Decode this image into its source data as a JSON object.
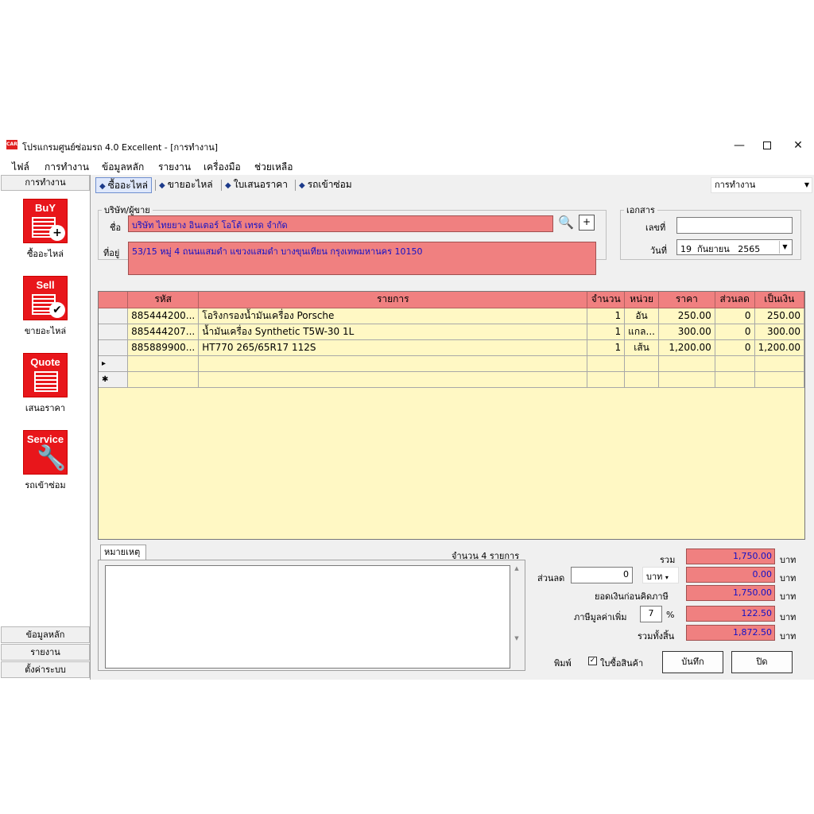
{
  "window": {
    "title": "โปรแกรมศูนย์ซ่อมรถ 4.0 Excellent - [การทำงาน]",
    "logo_text": "CAR",
    "minimize": "—",
    "close": "✕"
  },
  "menu": [
    "ไฟล์",
    "การทำงาน",
    "ข้อมูลหลัก",
    "รายงาน",
    "เครื่องมือ",
    "ช่วยเหลือ"
  ],
  "sidebar": {
    "header": "การทำงาน",
    "tiles": [
      {
        "word": "BuY",
        "label": "ซื้ออะไหล่",
        "icon": "buy-icon"
      },
      {
        "word": "Sell",
        "label": "ขายอะไหล่",
        "icon": "sell-icon"
      },
      {
        "word": "Quote",
        "label": "เสนอราคา",
        "icon": "quote-icon"
      },
      {
        "word": "Service",
        "label": "รถเข้าซ่อม",
        "icon": "service-icon"
      }
    ],
    "bottom": [
      "ข้อมูลหลัก",
      "รายงาน",
      "ตั้งค่าระบบ"
    ]
  },
  "tabs": [
    "ซื้ออะไหล่",
    "ขายอะไหล่",
    "ใบเสนอราคา",
    "รถเข้าซ่อม"
  ],
  "mode_select": "การทำงาน",
  "supplier": {
    "legend": "บริษัท/ผู้ขาย",
    "name_label": "ชื่อ",
    "name": "บริษัท ไทยยาง อินเตอร์ โอโต้ เทรด จำกัด",
    "address_label": "ที่อยู่",
    "address": "53/15 หมู่ 4 ถนนแสมดำ แขวงแสมดำ บางขุนเทียน กรุงเทพมหานคร 10150",
    "add_button": "+"
  },
  "document": {
    "legend": "เอกสาร",
    "number_label": "เลขที่",
    "number": "",
    "date_label": "วันที่",
    "date_day": "19",
    "date_month": "กันยายน",
    "date_year": "2565"
  },
  "grid": {
    "headers": [
      "รหัส",
      "รายการ",
      "จำนวน",
      "หน่วย",
      "ราคา",
      "ส่วนลด",
      "เป็นเงิน"
    ],
    "rows": [
      {
        "code": "885444200...",
        "item": "โอริงกรองน้ำมันเครื่อง Porsche",
        "qty": "1",
        "unit": "อัน",
        "price": "250.00",
        "discount": "0",
        "amount": "250.00"
      },
      {
        "code": "885444207...",
        "item": "น้ำมันเครื่อง Synthetic T5W-30 1L",
        "qty": "1",
        "unit": "แกล...",
        "price": "300.00",
        "discount": "0",
        "amount": "300.00"
      },
      {
        "code": "885889900...",
        "item": "HT770 265/65R17 112S",
        "qty": "1",
        "unit": "เส้น",
        "price": "1,200.00",
        "discount": "0",
        "amount": "1,200.00"
      }
    ],
    "current_row_marker": "▸",
    "new_row_marker": "✱"
  },
  "notes": {
    "tab": "หมายเหตุ",
    "count_text": "จำนวน 4 รายการ"
  },
  "totals": {
    "sum_label": "รวม",
    "sum": "1,750.00",
    "discount_label": "ส่วนลด",
    "discount_input": "0",
    "discount_unit": "บาท",
    "discount_value": "0.00",
    "before_vat_label": "ยอดเงินก่อนคิดภาษี",
    "before_vat": "1,750.00",
    "vat_label": "ภาษีมูลค่าเพิ่ม",
    "vat_rate": "7",
    "vat_pct": "%",
    "vat": "122.50",
    "grand_label": "รวมทั้งสิ้น",
    "grand": "1,872.50",
    "currency": "บาท"
  },
  "footer": {
    "print_label": "พิมพ์",
    "print_option": "ใบซื้อสินค้า",
    "print_checked": true,
    "save_button": "บันทึก",
    "close_button": "ปิด"
  }
}
